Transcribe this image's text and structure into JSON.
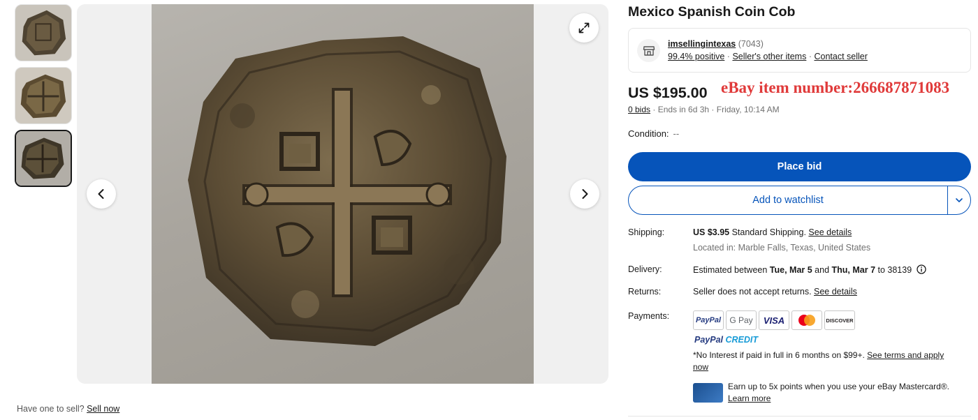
{
  "thumbnails": [
    {
      "label": "thumbnail-1",
      "active": false
    },
    {
      "label": "thumbnail-2",
      "active": false
    },
    {
      "label": "thumbnail-3",
      "active": true
    }
  ],
  "icons": {
    "prev": "chevron-left-icon",
    "next": "chevron-right-icon",
    "expand": "expand-icon",
    "store": "store-icon",
    "info": "info-icon",
    "dropdown": "chevron-down-icon"
  },
  "sell": {
    "prompt": "Have one to sell?",
    "link": "Sell now"
  },
  "listing": {
    "title": "Mexico Spanish Coin Cob",
    "price": "US $195.00",
    "watermark": "eBay item number:266687871083",
    "bids": "0 bids",
    "ends": " · Ends in 6d 3h · Friday, 10:14 AM",
    "condition_label": "Condition:",
    "condition_value": "--"
  },
  "seller": {
    "name": "imsellingintexas",
    "count": " (7043)",
    "positive": "99.4% positive",
    "other_items": "Seller's other items",
    "contact": "Contact seller"
  },
  "actions": {
    "place_bid": "Place bid",
    "watchlist": "Add to watchlist"
  },
  "shipping": {
    "label": "Shipping:",
    "price": "US $3.95",
    "method": " Standard Shipping. ",
    "details": "See details",
    "location": "Located in: Marble Falls, Texas, United States"
  },
  "delivery": {
    "label": "Delivery:",
    "prefix": "Estimated between ",
    "start": "Tue, Mar 5",
    "and": " and ",
    "end": "Thu, Mar 7",
    "to": " to 38139"
  },
  "returns": {
    "label": "Returns:",
    "text": "Seller does not accept returns. ",
    "details": "See details"
  },
  "payments": {
    "label": "Payments:",
    "methods": [
      "PayPal",
      "G Pay",
      "VISA",
      "Mastercard",
      "DISCOVER"
    ],
    "paypal_credit": "PayPal CREDIT",
    "interest": "*No Interest if paid in full in 6 months on $99+. ",
    "terms": "See terms and apply now",
    "earn": "Earn up to 5x points when you use your eBay Mastercard®. ",
    "learn_more": "Learn more"
  },
  "colors": {
    "accent": "#0654ba",
    "watermark": "#e03a3a",
    "paypal_blue": "#253b80",
    "paypal_light": "#179bd7"
  }
}
